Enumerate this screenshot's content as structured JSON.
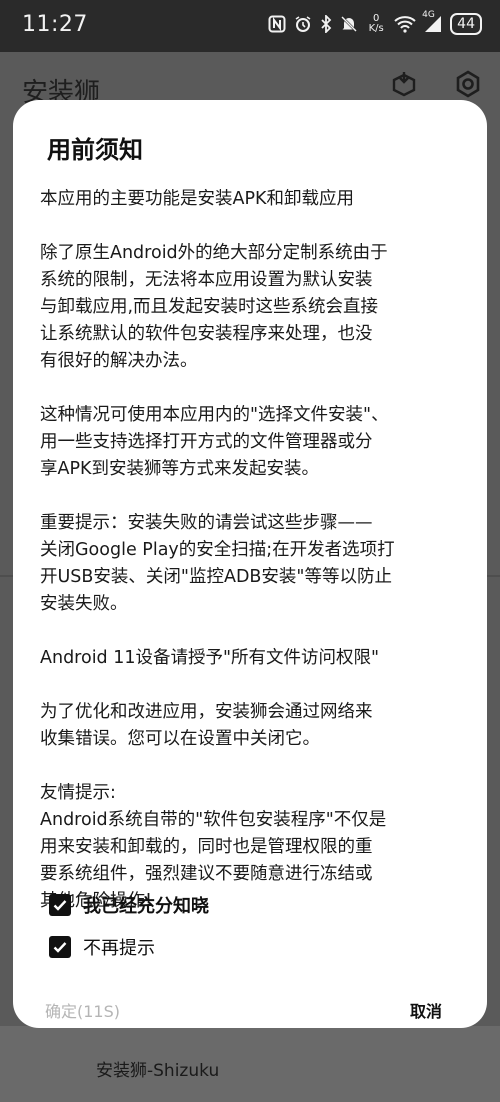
{
  "status_bar": {
    "time": "11:27",
    "net_speed_top": "0",
    "net_speed_bottom": "K/s",
    "signal_label": "4G",
    "battery": "44",
    "icons": [
      "nfc-icon",
      "alarm-icon",
      "bluetooth-icon",
      "mute-icon",
      "wifi-icon",
      "signal-icon"
    ]
  },
  "app": {
    "title": "安装狮",
    "bottom_label": "安装狮-Shizuku",
    "actions": [
      "package-icon",
      "settings-icon"
    ]
  },
  "dialog": {
    "title": "用前须知",
    "paragraphs": [
      "本应用的主要功能是安装APK和卸载应用",
      "除了原生Android外的绝大部分定制系统由于\n系统的限制，无法将本应用设置为默认安装\n与卸载应用,而且发起安装时这些系统会直接\n让系统默认的软件包安装程序来处理，也没\n有很好的解决办法。",
      "这种情况可使用本应用内的\"选择文件安装\"、\n用一些支持选择打开方式的文件管理器或分\n享APK到安装狮等方式来发起安装。",
      "重要提示：安装失败的请尝试这些步骤——\n关闭Google Play的安全扫描;在开发者选项打\n开USB安装、关闭\"监控ADB安装\"等等以防止\n安装失败。",
      "Android 11设备请授予\"所有文件访问权限\"",
      "为了优化和改进应用，安装狮会通过网络来\n收集错误。您可以在设置中关闭它。",
      "友情提示:\nAndroid系统自带的\"软件包安装程序\"不仅是\n用来安装和卸载的，同时也是管理权限的重\n要系统组件，强烈建议不要随意进行冻结或\n其他危险操作!"
    ],
    "checkbox_understood": {
      "label": "我已经充分知晓",
      "checked": true
    },
    "checkbox_dont_remind": {
      "label": "不再提示",
      "checked": true
    },
    "confirm_label": "确定(11S)",
    "cancel_label": "取消"
  },
  "colors": {
    "dialog_bg": "#ffffff",
    "text": "#1a1a1a",
    "disabled_text": "#b5b5b5",
    "scrim": "#5a5a5a"
  }
}
